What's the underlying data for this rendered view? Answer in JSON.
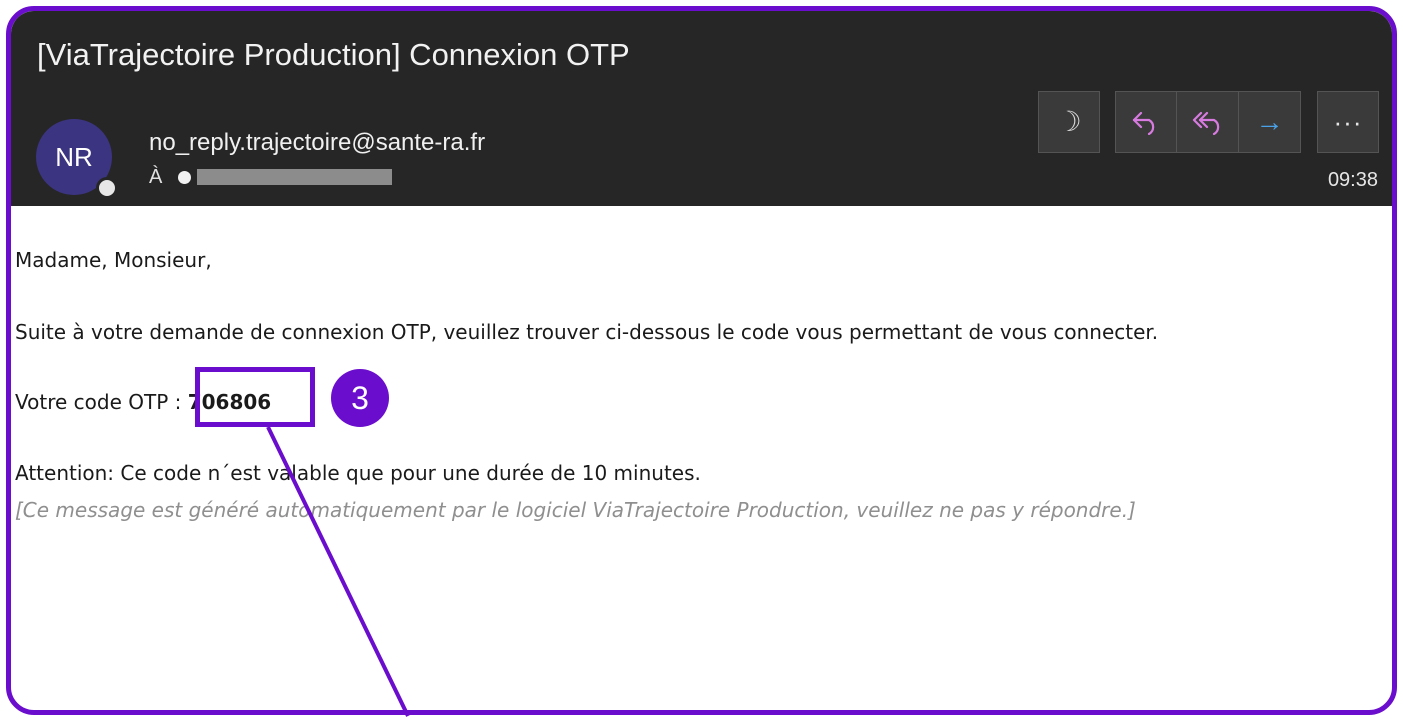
{
  "email": {
    "subject": "[ViaTrajectoire Production] Connexion OTP",
    "avatar_initials": "NR",
    "sender": "no_reply.trajectoire@sante-ra.fr",
    "to_label": "À",
    "time": "09:38"
  },
  "toolbar": {
    "moon_icon": "☽",
    "reply_icon": "⟲",
    "reply_all_icon": "≪",
    "forward_icon": "→",
    "more_icon": "···"
  },
  "body": {
    "greeting": "Madame, Monsieur,",
    "intro": "Suite à votre demande de connexion OTP, veuillez trouver ci-dessous le code vous permettant de vous connecter.",
    "otp_label": "Votre code OTP :",
    "otp_code": "706806",
    "warning": "Attention: Ce code n´est valable que pour une durée de 10 minutes.",
    "footer": "[Ce message est généré automatiquement par le logiciel ViaTrajectoire Production, veuillez ne pas y répondre.]"
  },
  "annotation": {
    "callout_number": "3",
    "accent_color": "#6a0dcd"
  }
}
